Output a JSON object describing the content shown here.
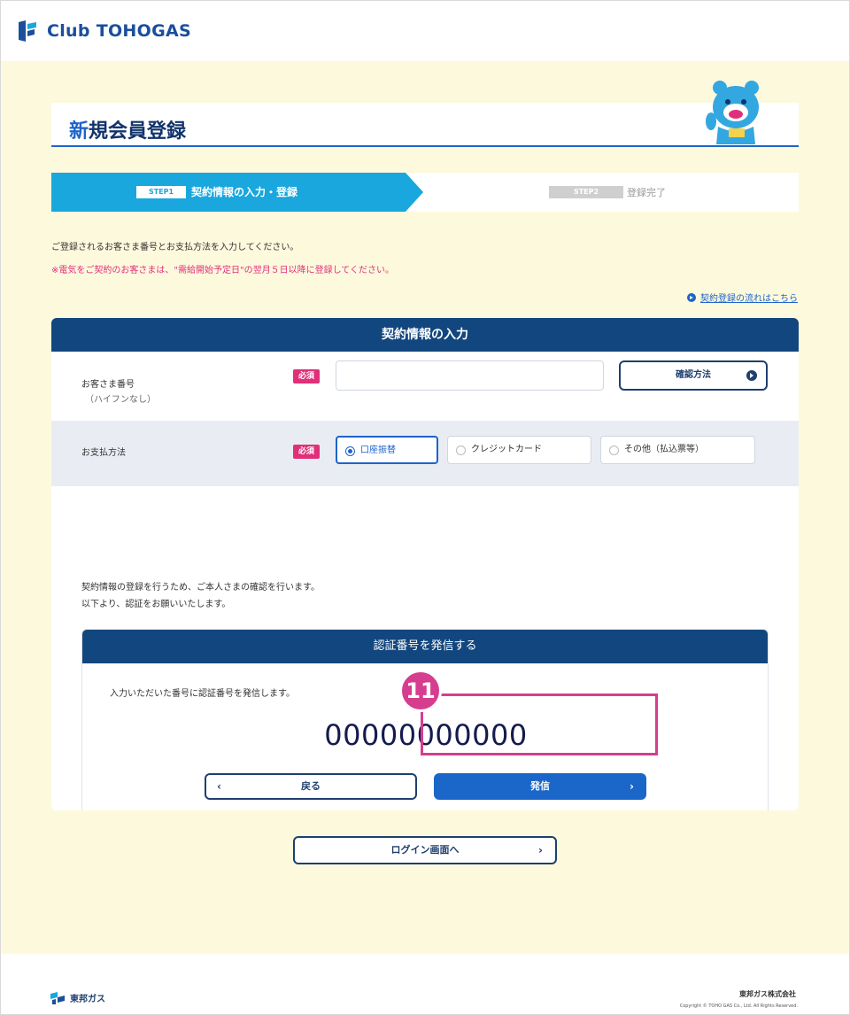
{
  "header": {
    "logo_text": "Club TOHOGAS"
  },
  "page": {
    "title_first": "新",
    "title_rest": "規会員登録"
  },
  "steps": [
    {
      "badge": "STEP1",
      "label": "契約情報の入力・登録",
      "active": true
    },
    {
      "badge": "STEP2",
      "label": "登録完了",
      "active": false
    }
  ],
  "intro": {
    "line1": "ご登録されるお客さま番号とお支払方法を入力してください。",
    "line2": "※電気をご契約のお客さまは、\"需給開始予定日\"の翌月５日以降に登録してください。",
    "flow_link": "契約登録の流れはこちら"
  },
  "form": {
    "heading": "契約情報の入力",
    "customer_label": "お客さま番号",
    "customer_sub": "（ハイフンなし）",
    "required": "必須",
    "customer_value": "",
    "check_button": "確認方法",
    "payment_label": "お支払方法",
    "payment_options": [
      {
        "label": "口座振替",
        "selected": true
      },
      {
        "label": "クレジットカード",
        "selected": false
      },
      {
        "label": "その他（払込票等）",
        "selected": false
      }
    ],
    "notice_line1": "契約情報の登録を行うため、ご本人さまの確認を行います。",
    "notice_line2": "以下より、認証をお願いいたします。"
  },
  "auth": {
    "heading": "認証番号を発信する",
    "text": "入力いただいた番号に認証番号を発信します。",
    "number": "00000000000",
    "back_button": "戻る",
    "send_button": "発信"
  },
  "annotation": {
    "step_number": "11",
    "color": "#d63d8e"
  },
  "login_button": "ログイン画面へ",
  "footer": {
    "logo_text": "東邦ガス",
    "company": "東邦ガス株式会社",
    "copyright": "Copyright © TOHO GAS Co., Ltd. All Rights Reserved."
  },
  "colors": {
    "navy": "#12467e",
    "accent_blue": "#1e63c9",
    "sky": "#19a7dd",
    "pink": "#e0307a",
    "cream": "#fdf9dd"
  }
}
